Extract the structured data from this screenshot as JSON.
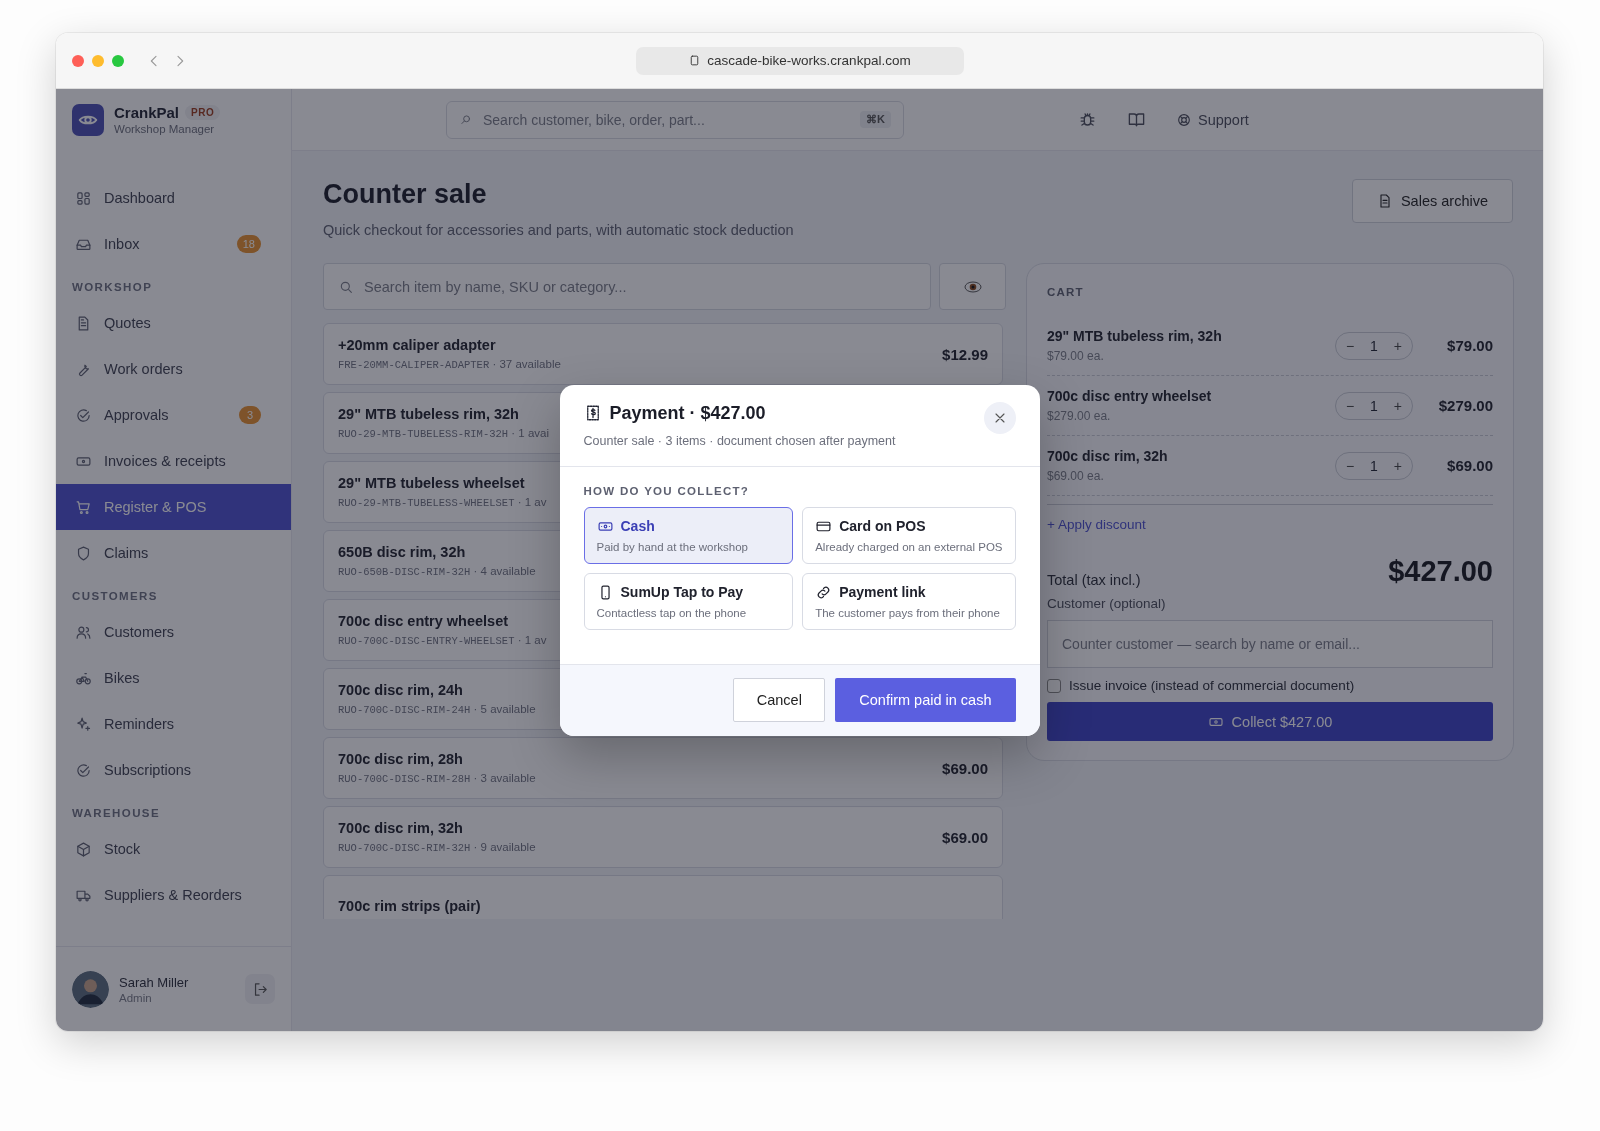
{
  "browser": {
    "url": "cascade-bike-works.crankpal.com"
  },
  "app": {
    "name": "CrankPal",
    "badge": "PRO",
    "subtitle": "Workshop Manager"
  },
  "topbar": {
    "search_placeholder": "Search customer, bike, order, part...",
    "shortcut": "⌘K",
    "support": "Support"
  },
  "sidebar": {
    "sections": [
      {
        "items": [
          {
            "label": "Dashboard",
            "selected": false
          },
          {
            "label": "Inbox",
            "badge": "18",
            "selected": false
          }
        ]
      },
      {
        "heading": "WORKSHOP",
        "items": [
          {
            "label": "Quotes",
            "selected": false
          },
          {
            "label": "Work orders",
            "selected": false
          },
          {
            "label": "Approvals",
            "badge": "3",
            "selected": false
          },
          {
            "label": "Invoices & receipts",
            "selected": false
          },
          {
            "label": "Register & POS",
            "selected": true
          },
          {
            "label": "Claims",
            "selected": false
          }
        ]
      },
      {
        "heading": "CUSTOMERS",
        "items": [
          {
            "label": "Customers",
            "selected": false
          },
          {
            "label": "Bikes",
            "selected": false
          },
          {
            "label": "Reminders",
            "selected": false
          },
          {
            "label": "Subscriptions",
            "selected": false
          }
        ]
      },
      {
        "heading": "WAREHOUSE",
        "items": [
          {
            "label": "Stock",
            "selected": false
          },
          {
            "label": "Suppliers & Reorders",
            "selected": false
          }
        ]
      }
    ],
    "user": {
      "name": "Sarah Miller",
      "role": "Admin"
    }
  },
  "page": {
    "title": "Counter sale",
    "subtitle": "Quick checkout for accessories and parts, with automatic stock deduction",
    "archive_button": "Sales archive",
    "item_search_placeholder": "Search item by name, SKU or category..."
  },
  "items": [
    {
      "name": "+20mm caliper adapter",
      "sku": "FRE-20MM-CALIPER-ADAPTER",
      "stock": "· 37 available",
      "price": "$12.99"
    },
    {
      "name": "29\" MTB tubeless rim, 32h",
      "sku": "RUO-29-MTB-TUBELESS-RIM-32H",
      "stock": "· 1 avai"
    },
    {
      "name": "29\" MTB tubeless wheelset",
      "sku": "RUO-29-MTB-TUBELESS-WHEELSET",
      "stock": "· 1 av"
    },
    {
      "name": "650B disc rim, 32h",
      "sku": "RUO-650B-DISC-RIM-32H",
      "stock": "· 4 available"
    },
    {
      "name": "700c disc entry wheelset",
      "sku": "RUO-700C-DISC-ENTRY-WHEELSET",
      "stock": "· 1 av"
    },
    {
      "name": "700c disc rim, 24h",
      "sku": "RUO-700C-DISC-RIM-24H",
      "stock": "· 5 available"
    },
    {
      "name": "700c disc rim, 28h",
      "sku": "RUO-700C-DISC-RIM-28H",
      "stock": "· 3 available",
      "price": "$69.00"
    },
    {
      "name": "700c disc rim, 32h",
      "sku": "RUO-700C-DISC-RIM-32H",
      "stock": "· 9 available",
      "price": "$69.00"
    },
    {
      "name": "700c rim strips (pair)"
    }
  ],
  "cart": {
    "heading": "CART",
    "lines": [
      {
        "name": "29\" MTB tubeless rim, 32h",
        "unit": "$79.00 ea.",
        "minus": "−",
        "qty": "1",
        "plus": "+",
        "total": "$79.00"
      },
      {
        "name": "700c disc entry wheelset",
        "unit": "$279.00 ea.",
        "minus": "−",
        "qty": "1",
        "plus": "+",
        "total": "$279.00"
      },
      {
        "name": "700c disc rim, 32h",
        "unit": "$69.00 ea.",
        "minus": "−",
        "qty": "1",
        "plus": "+",
        "total": "$69.00"
      }
    ],
    "discount_link": "+ Apply discount",
    "total_label": "Total (tax incl.)",
    "total": "$427.00",
    "customer_label": "Customer (optional)",
    "customer_placeholder": "Counter customer — search by name or email...",
    "invoice": {
      "label": "Issue invoice (instead of commercial document)",
      "checked": false
    },
    "collect_button": "Collect $427.00"
  },
  "modal": {
    "title": "Payment · $427.00",
    "subtitle": "Counter sale · 3 items · document chosen after payment",
    "question": "HOW DO YOU COLLECT?",
    "methods": [
      {
        "kind": "cash",
        "title": "Cash",
        "description": "Paid by hand at the workshop",
        "selected": true
      },
      {
        "kind": "card",
        "title": "Card on POS",
        "description": "Already charged on an external POS",
        "selected": false
      },
      {
        "kind": "phone",
        "title": "SumUp Tap to Pay",
        "description": "Contactless tap on the phone",
        "selected": false
      },
      {
        "kind": "link",
        "title": "Payment link",
        "description": "The customer pays from their phone",
        "selected": false
      }
    ],
    "cancel": "Cancel",
    "confirm": "Confirm paid in cash"
  }
}
